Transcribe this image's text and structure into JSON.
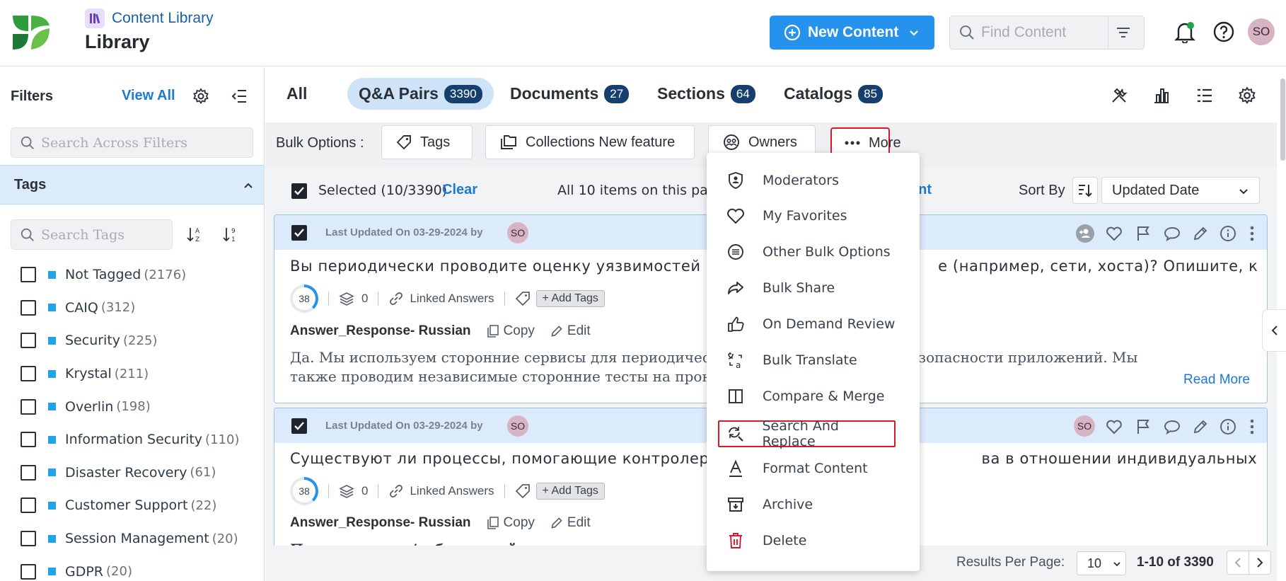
{
  "header": {
    "breadcrumb": "Content Library",
    "title": "Library",
    "new_button": "New Content",
    "search_placeholder": "Find Content",
    "avatar": "SO"
  },
  "sidebar": {
    "title": "Filters",
    "view_all": "View All",
    "search_placeholder": "Search Across Filters",
    "tags_heading": "Tags",
    "tag_search_placeholder": "Search Tags",
    "tags": [
      {
        "label": "Not Tagged",
        "count": "(2176)"
      },
      {
        "label": "CAIQ",
        "count": "(312)"
      },
      {
        "label": "Security",
        "count": "(225)"
      },
      {
        "label": "Krystal",
        "count": "(211)"
      },
      {
        "label": "Overlin",
        "count": "(198)"
      },
      {
        "label": "Information Security",
        "count": "(110)"
      },
      {
        "label": "Disaster Recovery",
        "count": "(61)"
      },
      {
        "label": "Customer Support",
        "count": "(22)"
      },
      {
        "label": "Session Management",
        "count": "(20)"
      },
      {
        "label": "GDPR",
        "count": "(20)"
      }
    ],
    "tag_color": "#21a3e8"
  },
  "tabs": [
    {
      "label": "All",
      "count": ""
    },
    {
      "label": "Q&A Pairs",
      "count": "3390"
    },
    {
      "label": "Documents",
      "count": "27"
    },
    {
      "label": "Sections",
      "count": "64"
    },
    {
      "label": "Catalogs",
      "count": "85"
    }
  ],
  "bulk": {
    "label": "Bulk Options :",
    "tags": "Tags",
    "collections": "Collections New feature",
    "owners": "Owners",
    "more": "More"
  },
  "selection": {
    "selected": "Selected (10/3390)",
    "clear": "Clear",
    "all_items": "All 10 items on this page",
    "all_items_link_tail": "ent",
    "sort_label": "Sort By",
    "sort_value": "Updated Date"
  },
  "cards": [
    {
      "updated": "Last Updated On 03-29-2024 by",
      "avatar": "SO",
      "question": "Вы периодически проводите оценку уязвимостей и  е (например, сети, хоста)? Опишите, к...",
      "question_left": "Вы периодически проводите оценку уязвимостей и",
      "question_right": "е (например, сети, хоста)? Опишите, к...",
      "score": "38",
      "layers": "0",
      "linked": "Linked Answers",
      "add_tags": "+ Add Tags",
      "answer_label": "Answer_Response- Russian",
      "copy": "Copy",
      "edit": "Edit",
      "answer_line1_left": "Да. Мы используем сторонние сервисы для периодическо",
      "answer_line1_right": "и безопасности приложений. Мы",
      "answer_line2": "также проводим независимые сторонние тесты на проник",
      "read_more": "Read More"
    },
    {
      "updated": "Last Updated On 03-29-2024 by",
      "avatar": "SO",
      "question_left": "Существуют ли процессы, помогающие контролер",
      "question_right": "ва в отношении индивидуальных пр...",
      "score": "38",
      "layers": "0",
      "linked": "Linked Answers",
      "add_tags": "+ Add Tags",
      "answer_label": "Answer_Response- Russian",
      "copy": "Copy",
      "edit": "Edit",
      "answer_line1": "Право доступа/субъектный доступ:",
      "owner_avatar": "SO"
    }
  ],
  "footer": {
    "rpp_label": "Results Per Page:",
    "rpp_value": "10",
    "range": "1-10 of 3390"
  },
  "more_menu": [
    {
      "label": "Moderators",
      "icon": "moderator-shield-icon"
    },
    {
      "label": "My Favorites",
      "icon": "heart-icon"
    },
    {
      "label": "Other Bulk Options",
      "icon": "list-circle-icon"
    },
    {
      "label": "Bulk Share",
      "icon": "share-arrow-icon"
    },
    {
      "label": "On Demand Review",
      "icon": "thumbs-up-icon"
    },
    {
      "label": "Bulk Translate",
      "icon": "translate-icon"
    },
    {
      "label": "Compare & Merge",
      "icon": "compare-icon"
    },
    {
      "label": "Search And Replace",
      "icon": "search-replace-icon"
    },
    {
      "label": "Format Content",
      "icon": "format-text-icon"
    },
    {
      "label": "Archive",
      "icon": "archive-icon"
    },
    {
      "label": "Delete",
      "icon": "trash-icon"
    }
  ],
  "colors": {
    "accent": "#2593ee",
    "link": "#1f78d1",
    "highlight_outline": "#d8192b",
    "delete": "#d8192b",
    "tab_active_bg": "#cfe3f8",
    "count_badge": "#163f6e"
  }
}
